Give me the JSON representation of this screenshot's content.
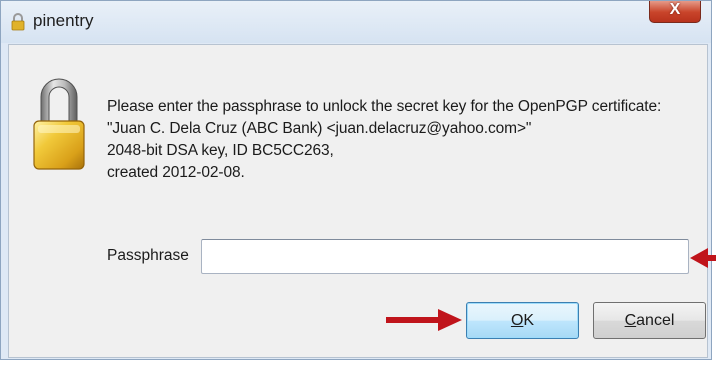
{
  "window": {
    "title": "pinentry"
  },
  "title_bar": {
    "close_glyph": "X"
  },
  "icons": {
    "lock": "padlock-icon",
    "app": "padlock-icon"
  },
  "message": {
    "line1": "Please enter the passphrase to unlock the secret key for the OpenPGP certificate:",
    "line2": "\"Juan C. Dela Cruz (ABC Bank) <juan.delacruz@yahoo.com>\"",
    "line3": "2048-bit DSA key, ID BC5CC263,",
    "line4": "created 2012-02-08."
  },
  "passphrase": {
    "label": "Passphrase",
    "value": ""
  },
  "buttons": {
    "ok_mnemonic": "O",
    "ok_rest": "K",
    "cancel_mnemonic": "C",
    "cancel_rest": "ancel"
  },
  "colors": {
    "accent_arrow": "#c0141b",
    "ok_border": "#3c7fb1",
    "close_red": "#c9452b"
  }
}
